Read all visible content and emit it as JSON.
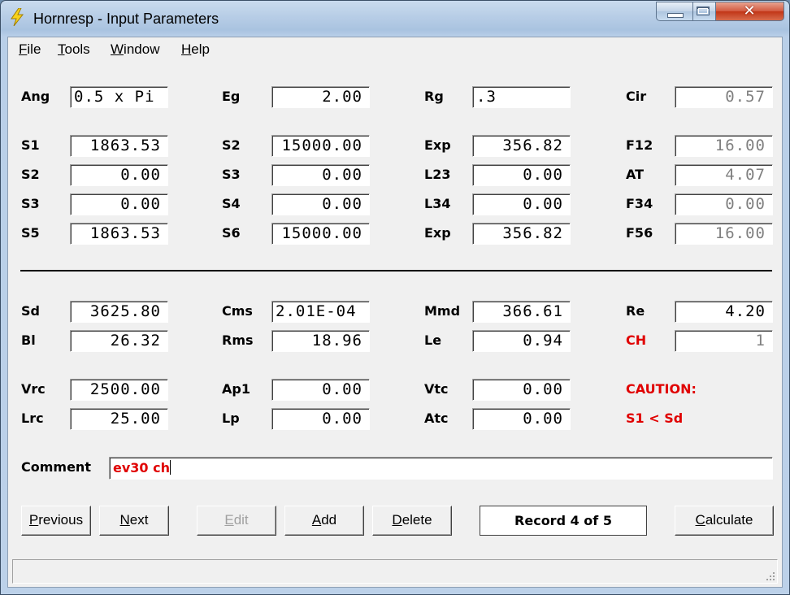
{
  "window": {
    "title": "Hornresp - Input Parameters",
    "close_symbol": "✕"
  },
  "menu": [
    {
      "label": "File",
      "hotkey": "F",
      "rest": "ile"
    },
    {
      "label": "Tools",
      "hotkey": "T",
      "rest": "ools"
    },
    {
      "label": "Window",
      "hotkey": "W",
      "rest": "indow"
    },
    {
      "label": "Help",
      "hotkey": "H",
      "rest": "elp"
    }
  ],
  "horn": {
    "ang": {
      "label": "Ang",
      "value": "0.5 x Pi"
    },
    "eg": {
      "label": "Eg",
      "value": "2.00"
    },
    "rg": {
      "label": "Rg",
      "value": ".3"
    },
    "cir": {
      "label": "Cir",
      "value": "0.57"
    },
    "r1": {
      "s_label": "S1",
      "s_value": "1863.53",
      "s2_label": "S2",
      "s2_value": "15000.00",
      "exp_label": "Exp",
      "exp_value": "356.82",
      "f_label": "F12",
      "f_value": "16.00"
    },
    "r2": {
      "s_label": "S2",
      "s_value": "0.00",
      "s2_label": "S3",
      "s2_value": "0.00",
      "exp_label": "L23",
      "exp_value": "0.00",
      "f_label": "AT",
      "f_value": "4.07"
    },
    "r3": {
      "s_label": "S3",
      "s_value": "0.00",
      "s2_label": "S4",
      "s2_value": "0.00",
      "exp_label": "L34",
      "exp_value": "0.00",
      "f_label": "F34",
      "f_value": "0.00"
    },
    "r4": {
      "s_label": "S5",
      "s_value": "1863.53",
      "s2_label": "S6",
      "s2_value": "15000.00",
      "exp_label": "Exp",
      "exp_value": "356.82",
      "f_label": "F56",
      "f_value": "16.00"
    }
  },
  "driver": {
    "sd": {
      "label": "Sd",
      "value": "3625.80"
    },
    "cms": {
      "label": "Cms",
      "value": "2.01E-04"
    },
    "mmd": {
      "label": "Mmd",
      "value": "366.61"
    },
    "re": {
      "label": "Re",
      "value": "4.20"
    },
    "bl": {
      "label": "Bl",
      "value": "26.32"
    },
    "rms": {
      "label": "Rms",
      "value": "18.96"
    },
    "le": {
      "label": "Le",
      "value": "0.94"
    },
    "ch": {
      "label": "CH",
      "value": "1"
    }
  },
  "chamber": {
    "vrc": {
      "label": "Vrc",
      "value": "2500.00"
    },
    "ap1": {
      "label": "Ap1",
      "value": "0.00"
    },
    "vtc": {
      "label": "Vtc",
      "value": "0.00"
    },
    "lrc": {
      "label": "Lrc",
      "value": "25.00"
    },
    "lp": {
      "label": "Lp",
      "value": "0.00"
    },
    "atc": {
      "label": "Atc",
      "value": "0.00"
    },
    "caution": "CAUTION:",
    "caution_detail": "S1 < Sd"
  },
  "comment": {
    "label": "Comment",
    "value": "ev30 ch"
  },
  "buttons": {
    "previous": {
      "hotkey": "P",
      "rest": "revious"
    },
    "next": {
      "hotkey": "N",
      "rest": "ext"
    },
    "edit": {
      "hotkey": "E",
      "rest": "dit"
    },
    "add": {
      "hotkey": "A",
      "rest": "dd"
    },
    "delete": {
      "hotkey": "D",
      "rest": "elete"
    },
    "calculate": {
      "hotkey": "C",
      "rest": "alculate"
    }
  },
  "record": "Record 4 of 5",
  "colors": {
    "warning": "#e00000",
    "readonly_text": "#808080"
  }
}
